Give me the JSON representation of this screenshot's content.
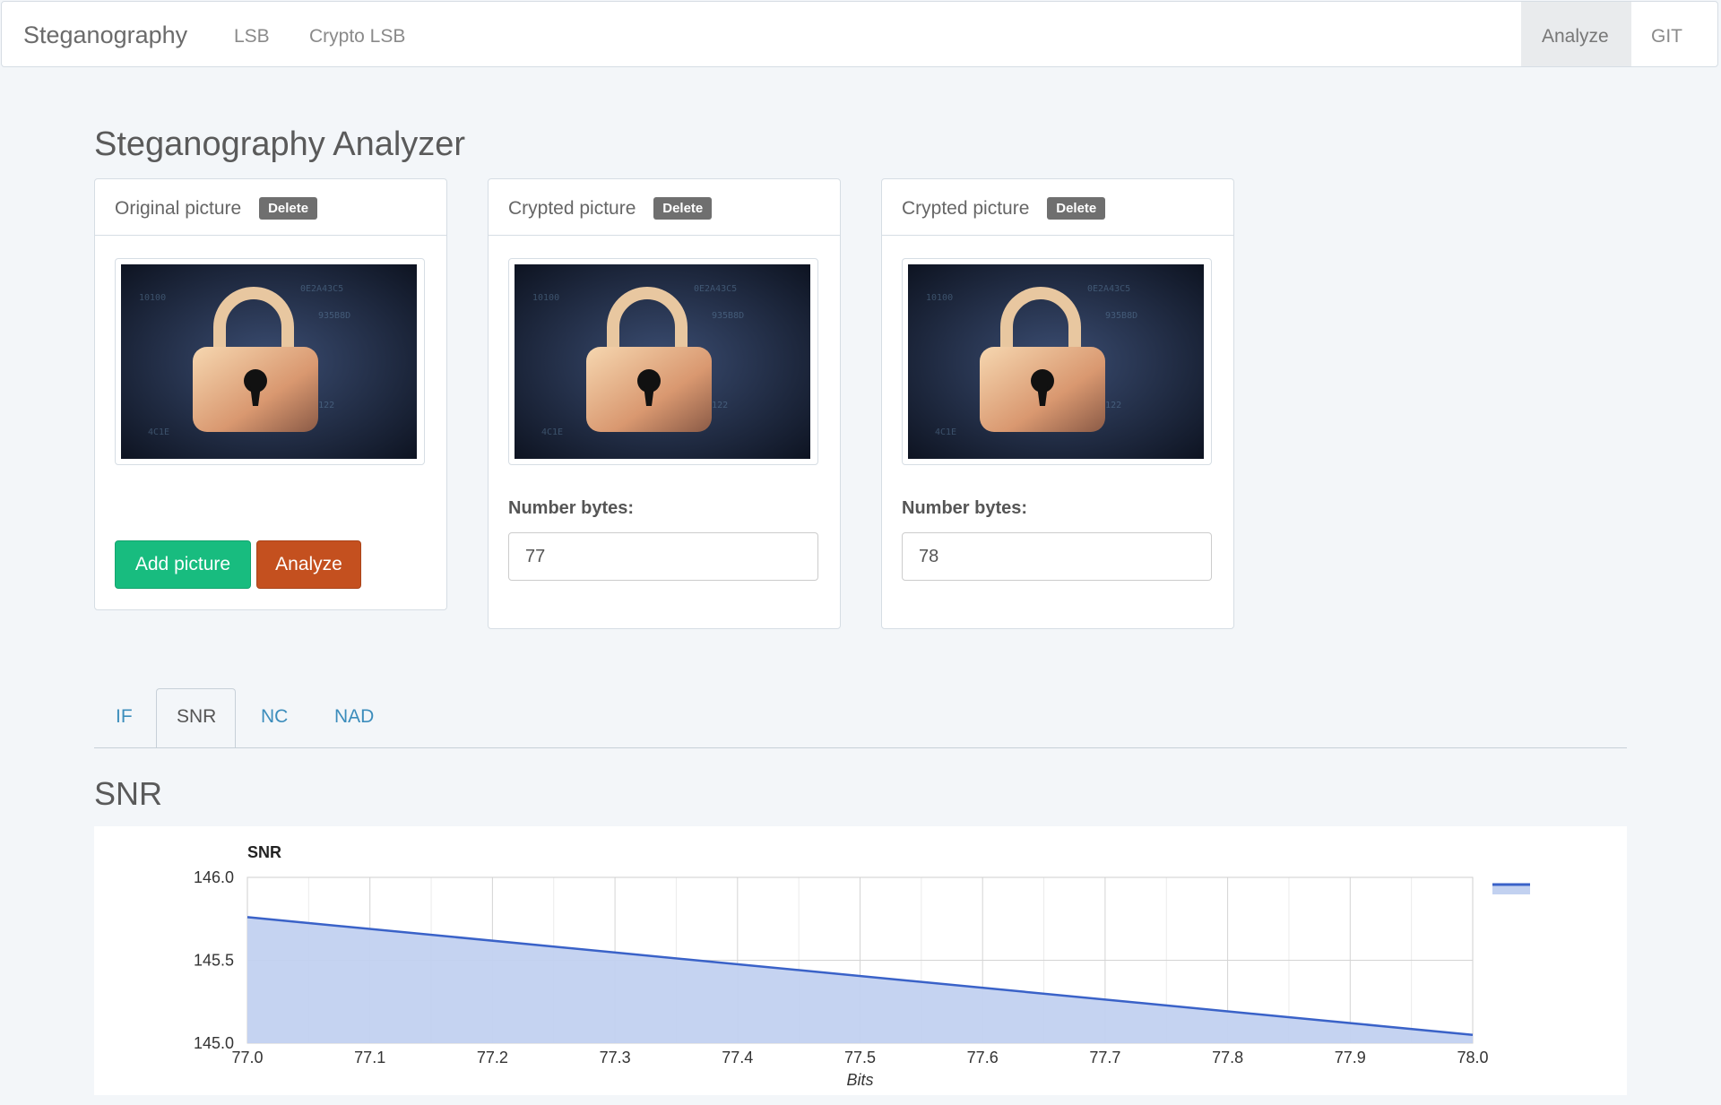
{
  "navbar": {
    "brand": "Steganography",
    "links": [
      "LSB",
      "Crypto LSB"
    ],
    "right_links": [
      "Analyze",
      "GIT"
    ],
    "active": "Analyze"
  },
  "page": {
    "title": "Steganography Analyzer"
  },
  "panels": [
    {
      "title": "Original picture",
      "delete_label": "Delete",
      "image": "padlock-image",
      "add_label": "Add picture",
      "analyze_label": "Analyze"
    },
    {
      "title": "Crypted picture",
      "delete_label": "Delete",
      "image": "padlock-image",
      "field_label": "Number bytes:",
      "field_value": "77"
    },
    {
      "title": "Crypted picture",
      "delete_label": "Delete",
      "image": "padlock-image",
      "field_label": "Number bytes:",
      "field_value": "78"
    }
  ],
  "tabs": [
    "IF",
    "SNR",
    "NC",
    "NAD"
  ],
  "active_tab": "SNR",
  "section_title": "SNR",
  "colors": {
    "success": "#18bc7f",
    "danger": "#c4501f",
    "link": "#3c8dbc",
    "series_line": "#3a62c8",
    "series_fill": "#c2d1f0"
  },
  "chart_data": {
    "type": "area",
    "title": "SNR",
    "xlabel": "Bits",
    "ylabel": "",
    "x": [
      77.0,
      78.0
    ],
    "series": [
      {
        "values": [
          145.76,
          145.05
        ]
      }
    ],
    "xlim": [
      77.0,
      78.0
    ],
    "ylim": [
      145.0,
      146.0
    ],
    "x_ticks": [
      "77.0",
      "77.1",
      "77.2",
      "77.3",
      "77.4",
      "77.5",
      "77.6",
      "77.7",
      "77.8",
      "77.9",
      "78.0"
    ],
    "y_ticks": [
      "145.0",
      "145.5",
      "146.0"
    ],
    "grid": true,
    "legend": "top-right"
  }
}
